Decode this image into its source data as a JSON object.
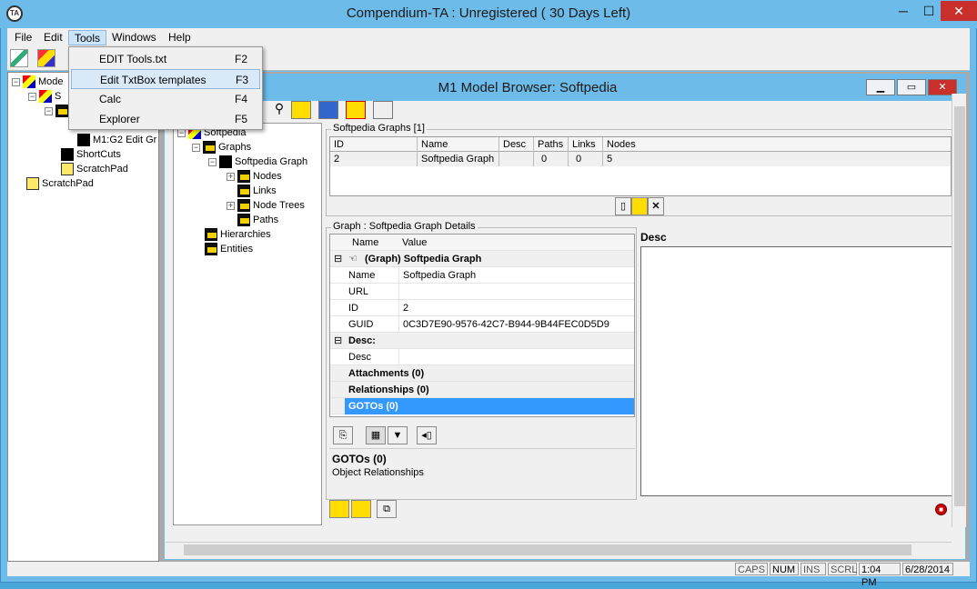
{
  "window": {
    "title": "Compendium-TA : Unregistered ( 30 Days Left)",
    "app_icon_text": "TA",
    "minimize": "─",
    "maximize": "☐",
    "close": "✕"
  },
  "menubar": {
    "items": [
      "File",
      "Edit",
      "Tools",
      "Windows",
      "Help"
    ]
  },
  "tools_menu": {
    "items": [
      {
        "label": "EDIT Tools.txt",
        "shortcut": "F2"
      },
      {
        "label": "Edit TxtBox templates",
        "shortcut": "F3"
      },
      {
        "label": "Calc",
        "shortcut": "F4"
      },
      {
        "label": "Explorer",
        "shortcut": "F5"
      }
    ]
  },
  "left_tree": {
    "items": [
      {
        "label": "Mode"
      },
      {
        "label": "S"
      },
      {
        "label": "M1:G2 Edit Gr"
      },
      {
        "label": "ShortCuts"
      },
      {
        "label": "ScratchPad"
      },
      {
        "label": "ScratchPad"
      }
    ]
  },
  "child_window": {
    "title": "M1 Model Browser: Softpedia"
  },
  "inner_tree": {
    "items": [
      {
        "label": "Softpedia"
      },
      {
        "label": "Graphs"
      },
      {
        "label": "Softpedia Graph"
      },
      {
        "label": "Nodes"
      },
      {
        "label": "Links"
      },
      {
        "label": "Node Trees"
      },
      {
        "label": "Paths"
      },
      {
        "label": "Hierarchies"
      },
      {
        "label": "Entities"
      }
    ]
  },
  "graphs_group": {
    "label": "Softpedia Graphs [1]",
    "columns": [
      "ID",
      "Name",
      "Desc",
      "Paths",
      "Links",
      "Nodes"
    ],
    "rows": [
      [
        "2",
        "Softpedia Graph",
        "",
        "0",
        "0",
        "5"
      ]
    ]
  },
  "details_group": {
    "label": "Graph : Softpedia Graph Details",
    "col_name": "Name",
    "col_value": "Value",
    "header_row": "(Graph) Softpedia Graph",
    "props": [
      {
        "name": "Name",
        "value": "Softpedia Graph"
      },
      {
        "name": "URL",
        "value": ""
      },
      {
        "name": "ID",
        "value": "2"
      },
      {
        "name": "GUID",
        "value": "0C3D7E90-9576-42C7-B944-9B44FEC0D5D9"
      }
    ],
    "desc_header": "Desc:",
    "desc_prop": {
      "name": "Desc",
      "value": ""
    },
    "attachments": "Attachments (0)",
    "relationships": "Relationships (0)",
    "gotos": "GOTOs (0)",
    "info_title": "GOTOs (0)",
    "info_text": "Object Relationships"
  },
  "desc_panel": {
    "label": "Desc"
  },
  "statusbar": {
    "caps": "CAPS",
    "num": "NUM",
    "ins": "INS",
    "scrl": "SCRL",
    "time": "1:04 PM",
    "date": "6/28/2014"
  }
}
